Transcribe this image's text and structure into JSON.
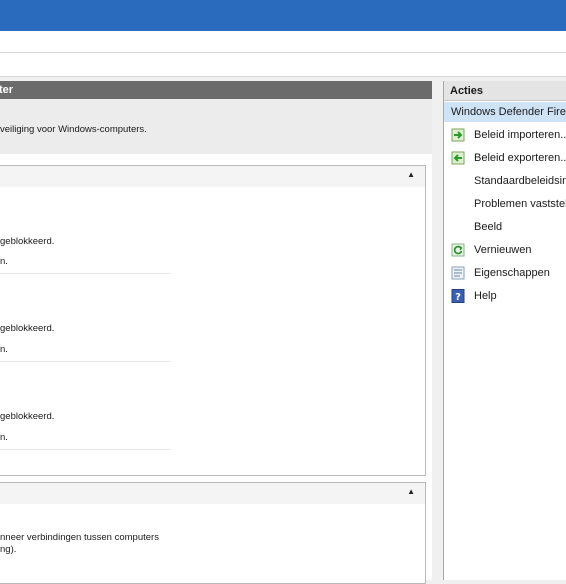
{
  "main": {
    "header_title": "ter",
    "intro_text": "veiliging voor Windows-computers.",
    "section1": {
      "profiles": [
        {
          "status": "geblokkeerd.",
          "note": "n."
        },
        {
          "status": "geblokkeerd.",
          "note": "n."
        },
        {
          "status": "geblokkeerd.",
          "note": "n."
        }
      ]
    },
    "section2": {
      "line1": "nneer verbindingen tussen computers",
      "line2": "ng)."
    },
    "collapse_glyph": "▲"
  },
  "actions": {
    "header": "Acties",
    "group": "Windows Defender Firew",
    "items": [
      {
        "label": "Beleid importeren...",
        "icon": "import-policy-icon"
      },
      {
        "label": "Beleid exporteren...",
        "icon": "export-policy-icon"
      },
      {
        "label": "Standaardbeleidsin",
        "icon": ""
      },
      {
        "label": "Problemen vaststell",
        "icon": ""
      },
      {
        "label": "Beeld",
        "icon": ""
      },
      {
        "label": "Vernieuwen",
        "icon": "refresh-icon"
      },
      {
        "label": "Eigenschappen",
        "icon": "properties-icon"
      },
      {
        "label": "Help",
        "icon": "help-icon"
      }
    ]
  },
  "colors": {
    "titlebar": "#2a6bbd",
    "header_bar": "#6b6b6b",
    "selected_group": "#cfe3f7"
  }
}
